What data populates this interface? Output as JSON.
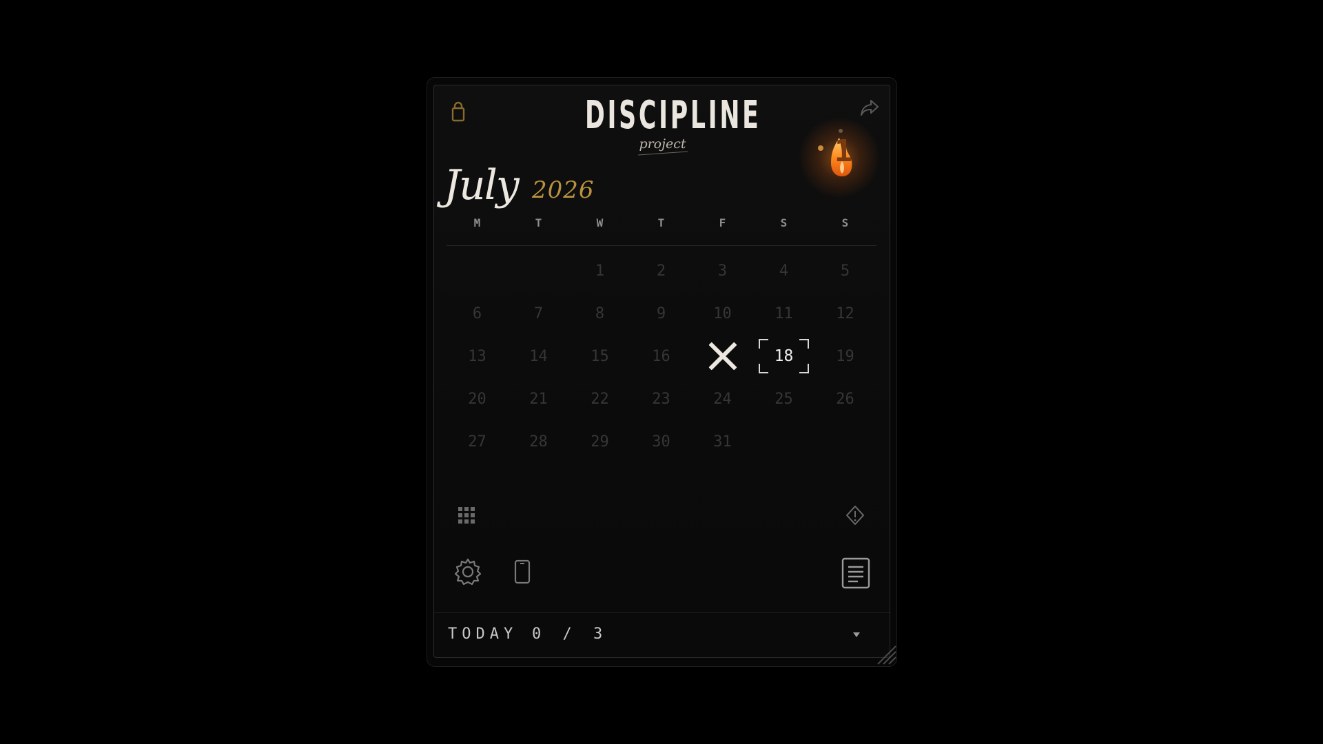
{
  "brand": {
    "title": "DISCIPLINE",
    "subtitle": "project"
  },
  "streak": {
    "count": "1",
    "flame_color": "#ff8a1e"
  },
  "calendar": {
    "month": "July",
    "year": "2026",
    "year_color": "#b8923e",
    "weekdays": [
      "M",
      "T",
      "W",
      "T",
      "F",
      "S",
      "S"
    ],
    "first_weekday_index": 2,
    "days_in_month": 31,
    "missed_days": [
      17
    ],
    "today": 18
  },
  "icons": {
    "top_left": "lock-icon",
    "top_right": "share-icon",
    "streak": "flame-icon",
    "bottom_left_row1": "grid-icon",
    "bottom_right_row1": "alert-diamond-icon",
    "bottom_left_row2_a": "gear-icon",
    "bottom_left_row2_b": "phone-icon",
    "bottom_right_row2": "notes-icon"
  },
  "footer": {
    "label": "TODAY",
    "count": "0 / 3"
  }
}
